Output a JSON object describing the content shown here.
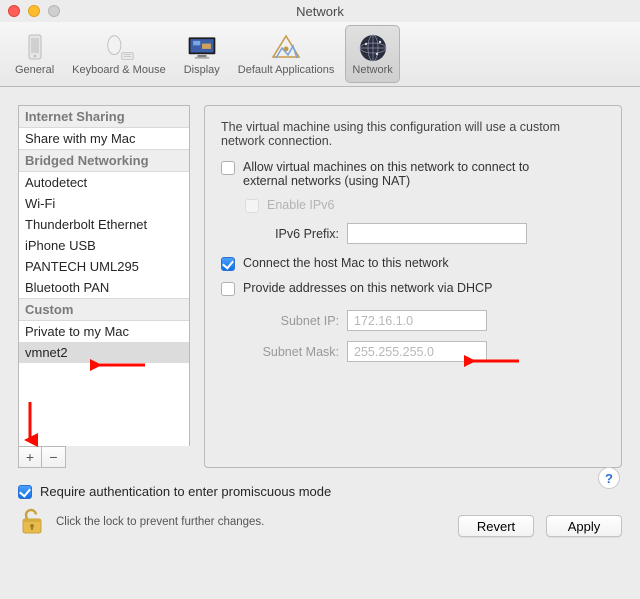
{
  "window": {
    "title": "Network"
  },
  "toolbar": {
    "items": [
      {
        "label": "General"
      },
      {
        "label": "Keyboard & Mouse"
      },
      {
        "label": "Display"
      },
      {
        "label": "Default Applications"
      },
      {
        "label": "Network"
      }
    ],
    "selected_index": 4
  },
  "sidebar": {
    "groups": [
      {
        "header": "Internet Sharing",
        "items": [
          "Share with my Mac"
        ]
      },
      {
        "header": "Bridged Networking",
        "items": [
          "Autodetect",
          "Wi-Fi",
          "Thunderbolt Ethernet",
          "iPhone USB",
          "PANTECH UML295",
          "Bluetooth PAN"
        ]
      },
      {
        "header": "Custom",
        "items": [
          "Private to my Mac",
          "vmnet2"
        ]
      }
    ],
    "selected_item": "vmnet2",
    "add_tooltip": "+",
    "remove_tooltip": "−"
  },
  "panel": {
    "description": "The virtual machine using this configuration will use a custom network connection.",
    "allow_nat_label": "Allow virtual machines on this network to connect to external networks (using NAT)",
    "allow_nat_checked": false,
    "enable_ipv6_label": "Enable IPv6",
    "enable_ipv6_checked": false,
    "enable_ipv6_disabled": true,
    "ipv6_prefix_label": "IPv6 Prefix:",
    "ipv6_prefix_value": "",
    "connect_host_label": "Connect the host Mac to this network",
    "connect_host_checked": true,
    "dhcp_label": "Provide addresses on this network via DHCP",
    "dhcp_checked": false,
    "subnet_ip_label": "Subnet IP:",
    "subnet_ip_value": "172.16.1.0",
    "subnet_mask_label": "Subnet Mask:",
    "subnet_mask_value": "255.255.255.0",
    "help_symbol": "?"
  },
  "footer": {
    "auth_label": "Require authentication to enter promiscuous mode",
    "auth_checked": true,
    "lock_text": "Click the lock to prevent further changes.",
    "revert_label": "Revert",
    "apply_label": "Apply"
  },
  "colors": {
    "accent": "#1470e6",
    "annotation": "#ff0a00"
  }
}
